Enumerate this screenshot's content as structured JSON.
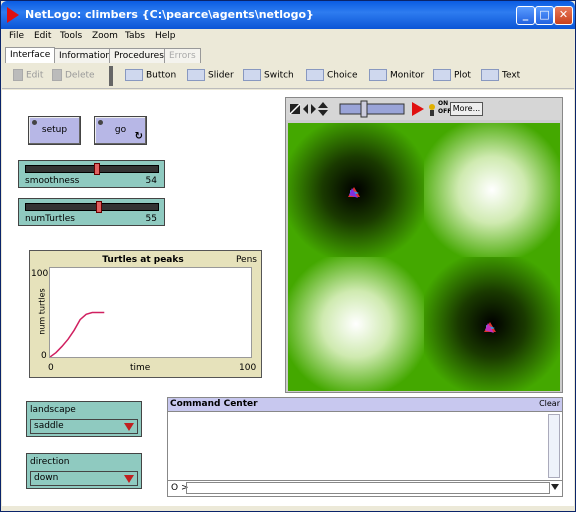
{
  "window": {
    "title": "NetLogo: climbers {C:\\pearce\\agents\\netlogo}",
    "minimize": "_",
    "maximize": "□",
    "close": "✕"
  },
  "menu": [
    "File",
    "Edit",
    "Tools",
    "Zoom",
    "Tabs",
    "Help"
  ],
  "tabs": [
    {
      "label": "Interface",
      "active": true
    },
    {
      "label": "Information"
    },
    {
      "label": "Procedures"
    },
    {
      "label": "Errors",
      "disabled": true
    }
  ],
  "toolbar": {
    "edit": "Edit",
    "delete": "Delete",
    "button": "Button",
    "slider": "Slider",
    "switch": "Switch",
    "choice": "Choice",
    "monitor": "Monitor",
    "plot": "Plot",
    "text": "Text"
  },
  "buttons": {
    "setup": "setup",
    "go": "go"
  },
  "sliders": [
    {
      "name": "smoothness",
      "value": "54",
      "fraction": 0.54
    },
    {
      "name": "numTurtles",
      "value": "55",
      "fraction": 0.55
    }
  ],
  "plot": {
    "title": "Turtles at peaks",
    "pens": "Pens",
    "ylabel": "num turtles",
    "xlabel": "time",
    "ymax": "100",
    "ymin": "0",
    "xmin": "0",
    "xmax": "100"
  },
  "chart_data": {
    "type": "line",
    "title": "Turtles at peaks",
    "xlabel": "time",
    "ylabel": "num turtles",
    "xlim": [
      0,
      100
    ],
    "ylim": [
      0,
      100
    ],
    "series": [
      {
        "values": [
          [
            0,
            0
          ],
          [
            3,
            5
          ],
          [
            6,
            12
          ],
          [
            9,
            20
          ],
          [
            12,
            30
          ],
          [
            15,
            42
          ],
          [
            18,
            48
          ],
          [
            21,
            50
          ],
          [
            24,
            50
          ],
          [
            27,
            50
          ]
        ],
        "color": "#d02060"
      }
    ]
  },
  "choosers": [
    {
      "label": "landscape",
      "value": "saddle"
    },
    {
      "label": "direction",
      "value": "down"
    }
  ],
  "view": {
    "more": "More...",
    "on": "ON",
    "off": "OFF"
  },
  "command_center": {
    "title": "Command Center",
    "clear": "Clear",
    "prompt": "O >"
  },
  "colors": {
    "patch_green": "#44a800",
    "accent_red": "#e01010"
  }
}
